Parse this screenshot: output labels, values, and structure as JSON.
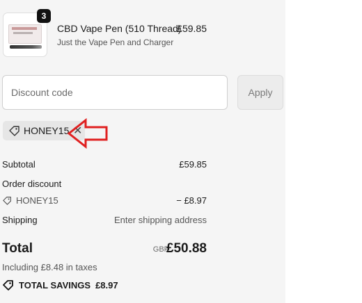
{
  "product": {
    "quantity": "3",
    "name": "CBD Vape Pen (510 Thread)",
    "variant": "Just the Vape Pen and Charger",
    "price": "£59.85",
    "thumbnail_icon": "product-image"
  },
  "discount": {
    "placeholder": "Discount code",
    "apply_label": "Apply",
    "applied_code": "HONEY15",
    "tag_icon": "tag-icon",
    "remove_icon": "close-icon"
  },
  "annotation": {
    "arrow_color": "#e02020"
  },
  "summary": {
    "subtotal_label": "Subtotal",
    "subtotal_value": "£59.85",
    "order_discount_label": "Order discount",
    "discount_code": "HONEY15",
    "discount_value": "− £8.97",
    "shipping_label": "Shipping",
    "shipping_value": "Enter shipping address",
    "total_label": "Total",
    "currency": "GBP",
    "total_value": "£50.88",
    "taxes_text": "Including £8.48 in taxes",
    "savings_label": "TOTAL SAVINGS",
    "savings_value": "£8.97"
  },
  "colors": {
    "panel_bg": "#f5f5f5",
    "badge_bg": "#111111",
    "arrow": "#e02020"
  }
}
